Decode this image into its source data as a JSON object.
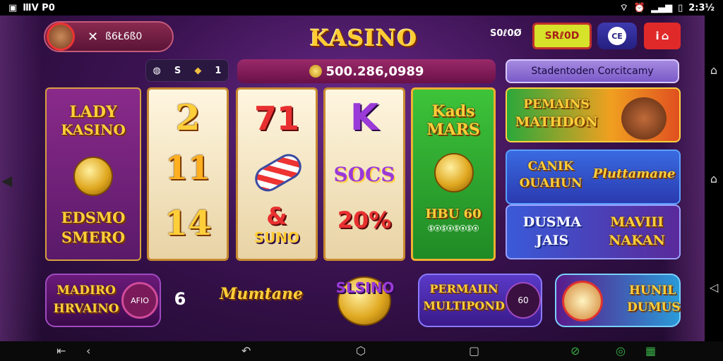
{
  "status": {
    "left": "ⅢⅤ P0",
    "time": "2:3½"
  },
  "header": {
    "profile_id": "ß6Ł6ß0",
    "logo": "KASINO",
    "score": "S0ℓ0Ø",
    "shop_label": "SRℓ0D",
    "ce_label": "CE",
    "home_label": "i"
  },
  "chips": {
    "a": "S",
    "b": "1"
  },
  "balance": "500.286,0989",
  "promo_bar": "Stadentoden Corcitcamy",
  "reels": {
    "lady": {
      "title1": "LADY",
      "title2": "KASINO",
      "bottom1": "EDSMO",
      "bottom2": "SMERO"
    },
    "r1": {
      "s1": "2",
      "s2": "11",
      "s3": "14"
    },
    "r2": {
      "s1": "71",
      "s3": "SUNO",
      "amp": "&"
    },
    "r3": {
      "s1": "K",
      "s2": "SOCS",
      "s3": "20%"
    },
    "r4": {
      "title1": "Kads",
      "title2": "MARS",
      "bottom": "HBU 60",
      "small": "ⓈⓐⓈⓐⓈⓐⓈⓐ"
    }
  },
  "cards": [
    {
      "line1": "PEMAINS",
      "line2": "MATHDON"
    },
    {
      "line1": "CANIK",
      "line2": "OUAHUN",
      "right": "Pluttamane"
    },
    {
      "line1": "DUSMA",
      "line2": "JAIS",
      "right1": "MAVIII",
      "right2": "NAKAN"
    }
  ],
  "bottom": {
    "b1_line1": "MADIRO",
    "b1_line2": "HRVAINO",
    "b1_badge": "AFIO",
    "b2_num": "6",
    "b3": "Mumtane",
    "b4": "SLSINO",
    "b5_line1": "PERMAIIN",
    "b5_line2": "MULTIPOND",
    "b5_badge": "60",
    "b6_line1": "HUNIL",
    "b6_line2": "DUMUS"
  },
  "icons": [
    "close-icon",
    "home-icon",
    "back-icon",
    "home-nav-icon",
    "recents-icon"
  ]
}
